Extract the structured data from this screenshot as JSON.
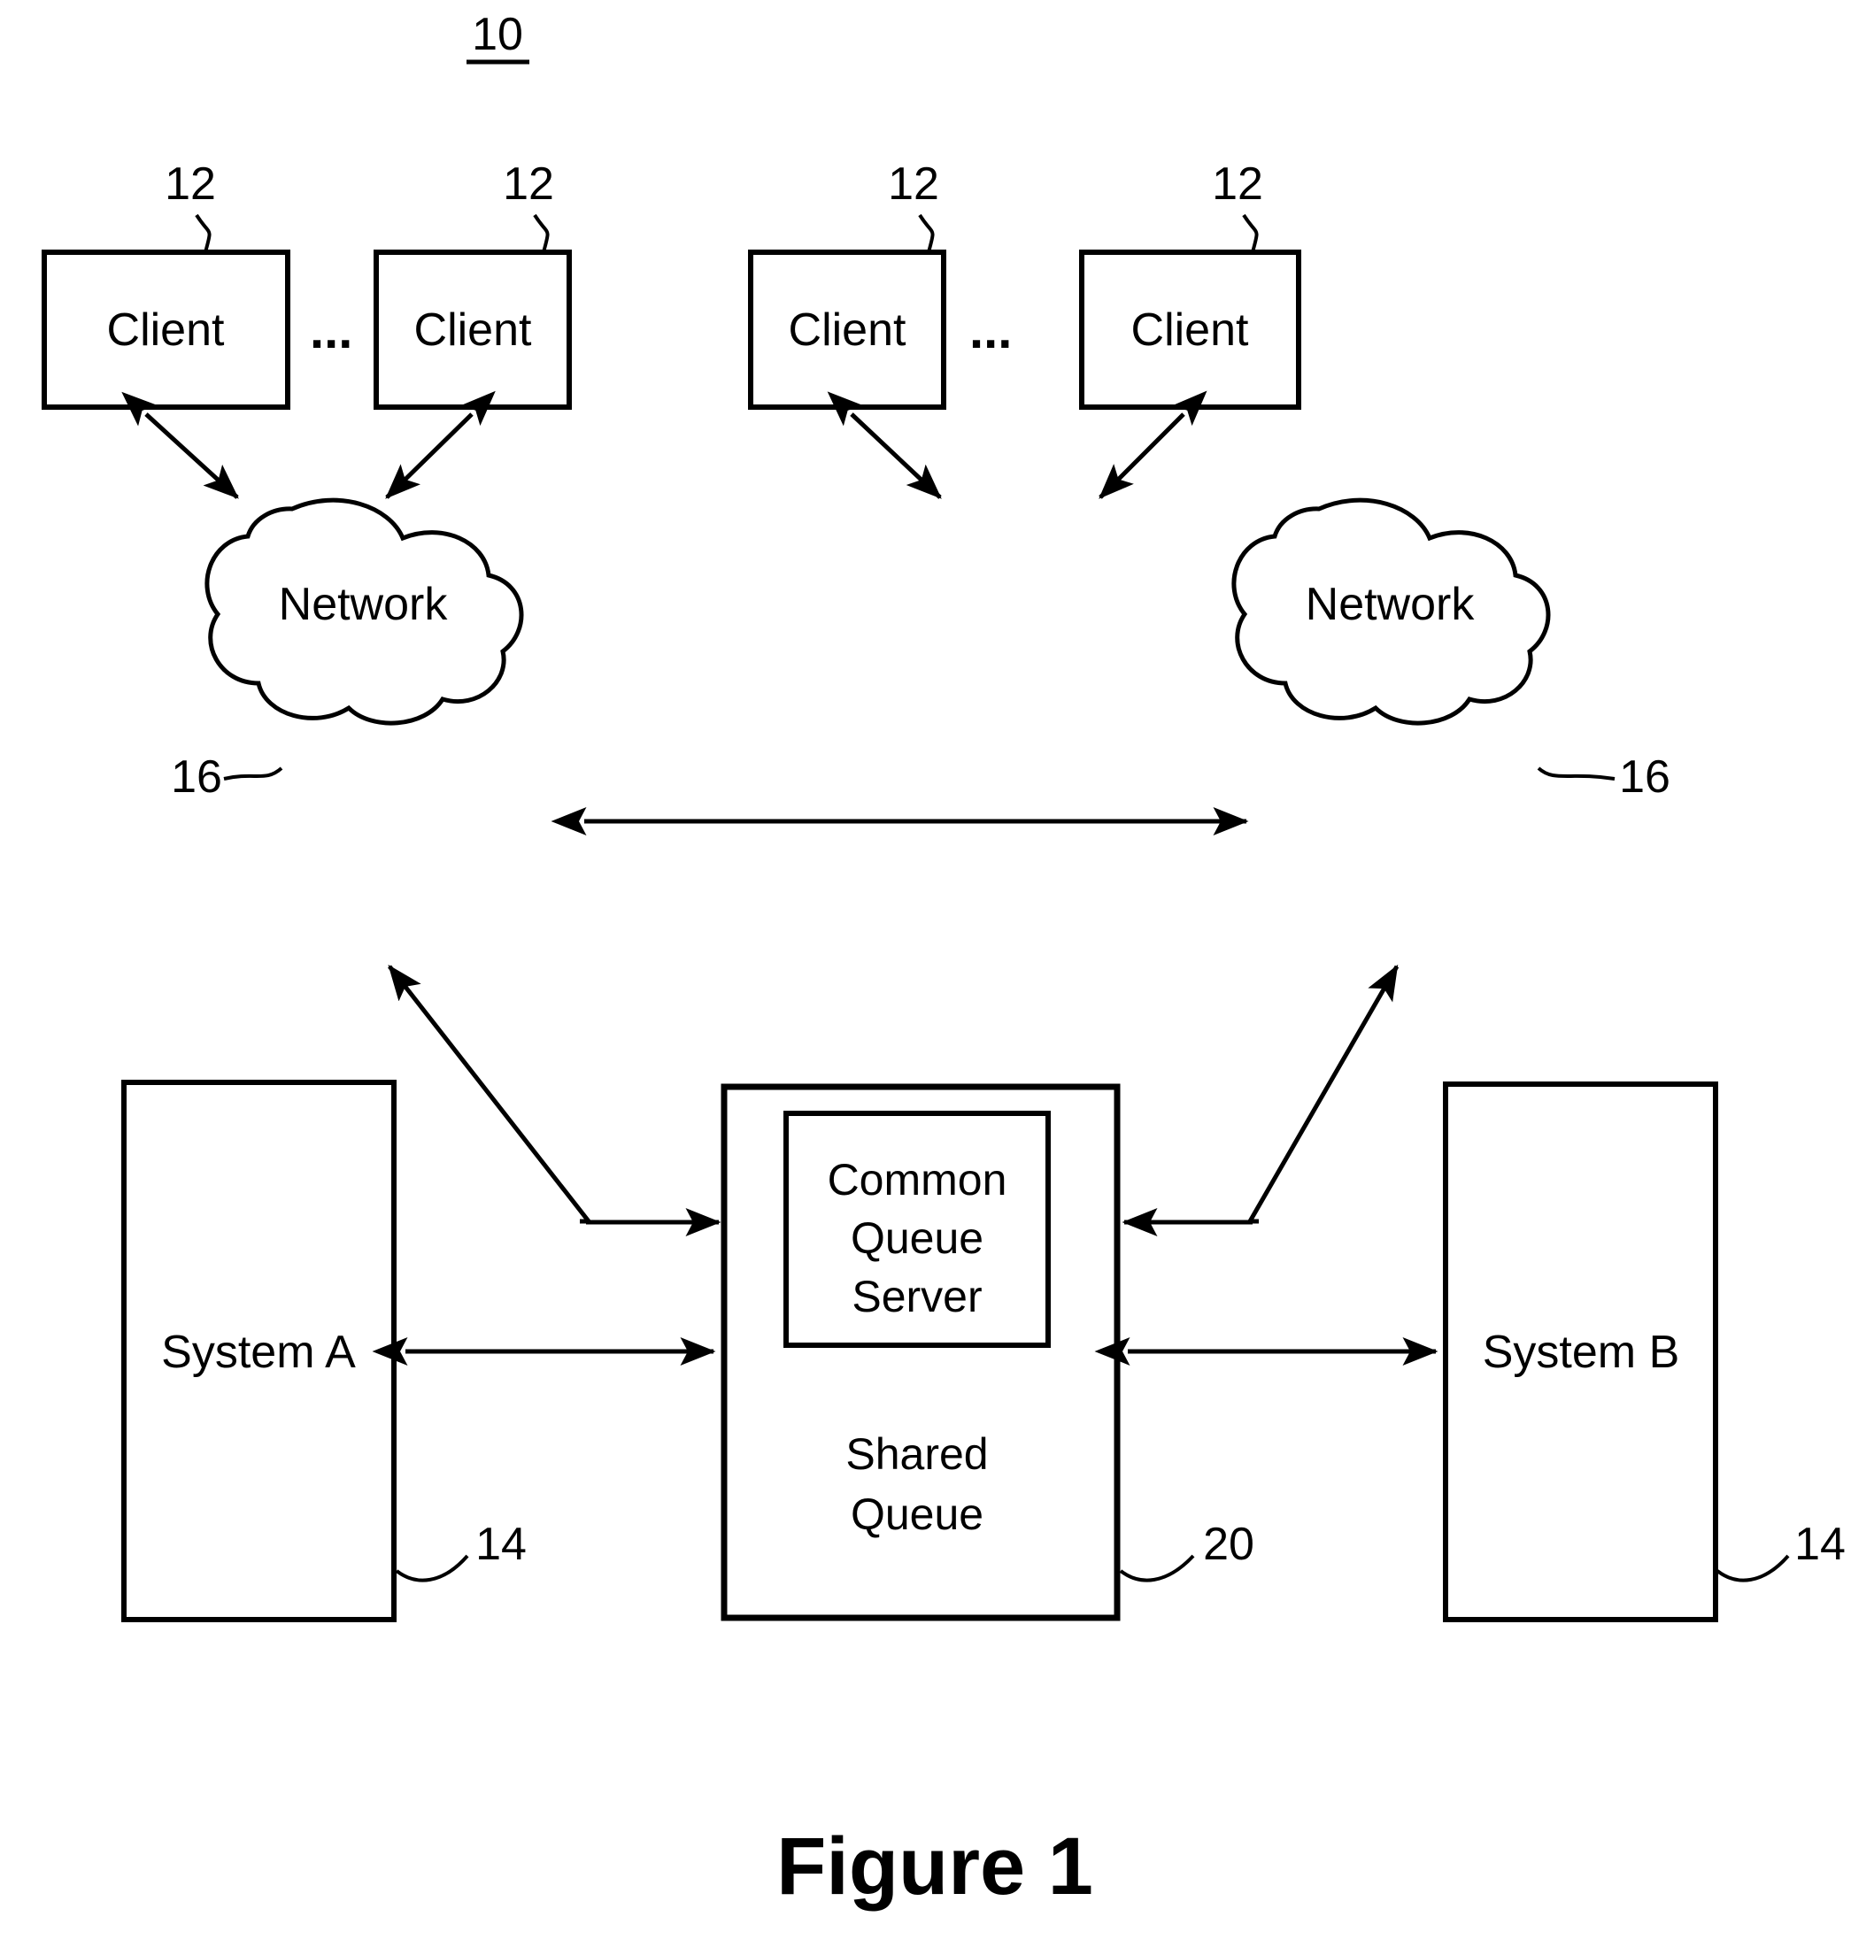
{
  "figure": {
    "top_ref": "10",
    "caption": "Figure 1"
  },
  "clients": [
    {
      "label": "Client",
      "ref": "12"
    },
    {
      "label": "Client",
      "ref": "12"
    },
    {
      "label": "Client",
      "ref": "12"
    },
    {
      "label": "Client",
      "ref": "12"
    }
  ],
  "ellipsis": {
    "left": "...",
    "right": "..."
  },
  "networks": [
    {
      "label": "Network",
      "ref": "16"
    },
    {
      "label": "Network",
      "ref": "16"
    }
  ],
  "systems": [
    {
      "label": "System A",
      "ref": "14"
    },
    {
      "label": "System B",
      "ref": "14"
    }
  ],
  "shared_queue": {
    "outer_label_line1": "Shared",
    "outer_label_line2": "Queue",
    "ref": "20",
    "inner": {
      "line1": "Common",
      "line2": "Queue",
      "line3": "Server"
    }
  },
  "colors": {
    "stroke": "#000000",
    "background": "#ffffff"
  }
}
